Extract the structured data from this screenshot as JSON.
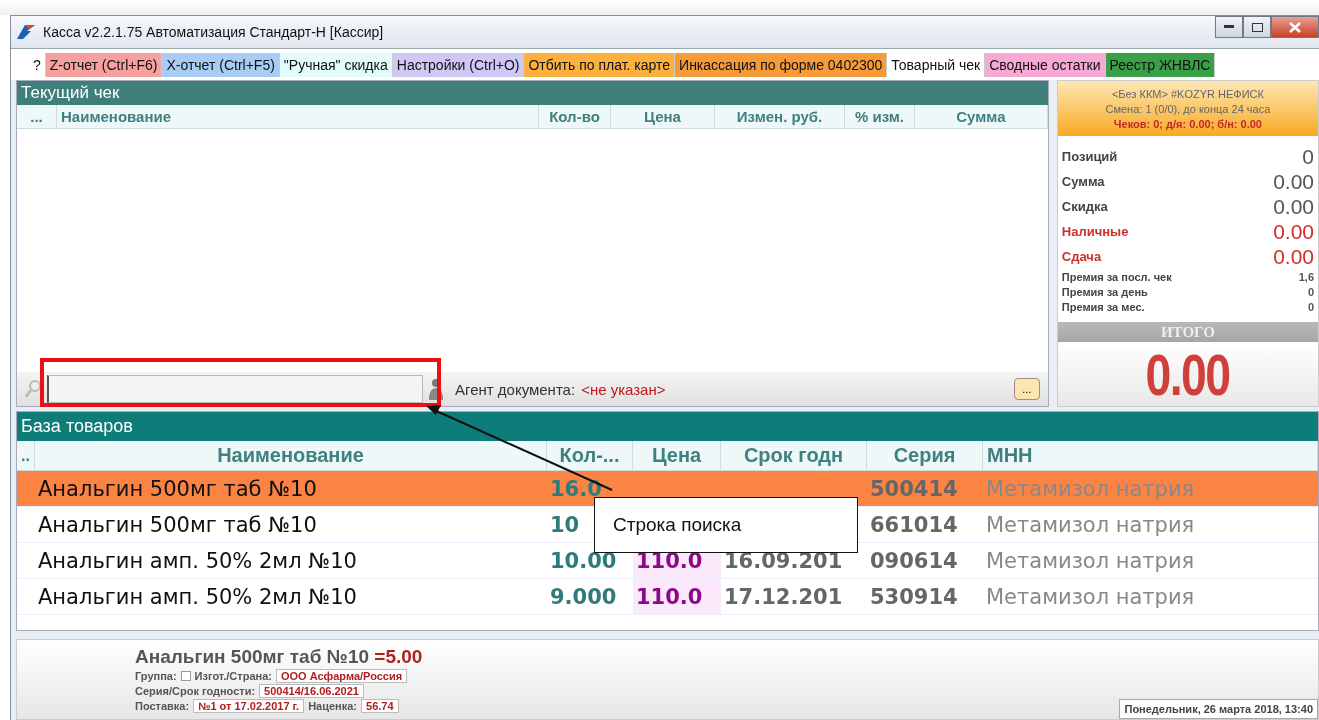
{
  "window": {
    "title": "Касса v2.2.1.75 Автоматизация Стандарт-Н [Кассир]"
  },
  "toolbar": [
    {
      "label": "?",
      "color": "#ffffff"
    },
    {
      "label": "Z-отчет (Ctrl+F6)",
      "color": "#f6a0a0"
    },
    {
      "label": "X-отчет (Ctrl+F5)",
      "color": "#a8ccf4"
    },
    {
      "label": "\"Ручная\" скидка",
      "color": "#e4fbfb"
    },
    {
      "label": "Настройки (Ctrl+O)",
      "color": "#cfc8f4"
    },
    {
      "label": "Отбить по плат. карте",
      "color": "#fbb040"
    },
    {
      "label": "Инкассация по форме 0402300",
      "color": "#f79a3a"
    },
    {
      "label": "Товарный чек",
      "color": "#ffffff"
    },
    {
      "label": "Сводные остатки",
      "color": "#f7a8d4"
    },
    {
      "label": "Реестр ЖНВЛС",
      "color": "#3aa048"
    }
  ],
  "current_check": {
    "title": "Текущий чек",
    "columns": [
      "...",
      "Наименование",
      "Кол-во",
      "Цена",
      "Измен. руб.",
      "% изм.",
      "Сумма"
    ],
    "agent_label": "Агент документа:",
    "agent_value": "<не указан>",
    "more_button": "..."
  },
  "register": {
    "header": [
      "<Без ККМ> #KOZYR НЕФИСК",
      "Смена: 1 (0/0), до конца 24 часа"
    ],
    "header_alert": "Чеков: 0; д/я: 0.00; б/н: 0.00",
    "stats": [
      {
        "label": "Позиций",
        "value": "0",
        "kind": "main"
      },
      {
        "label": "Сумма",
        "value": "0.00",
        "kind": "main"
      },
      {
        "label": "Скидка",
        "value": "0.00",
        "kind": "main"
      },
      {
        "label": "Наличные",
        "value": "0.00",
        "kind": "alert"
      },
      {
        "label": "Сдача",
        "value": "0.00",
        "kind": "alert"
      },
      {
        "label": "Премия за посл. чек",
        "value": "1,6",
        "kind": "small"
      },
      {
        "label": "Премия за день",
        "value": "0",
        "kind": "small"
      },
      {
        "label": "Премия за мес.",
        "value": "0",
        "kind": "small"
      }
    ],
    "total_label": "ИТОГО",
    "total": "0.00"
  },
  "products": {
    "title": "База товаров",
    "columns": [
      "..",
      "Наименование",
      "Кол-...",
      "Цена",
      "Срок годн",
      "Серия",
      "МНН"
    ],
    "rows": [
      {
        "selected": true,
        "name": "Анальгин 500мг таб №10",
        "qty": "16.0",
        "series": "500414",
        "inn": "Метамизол натрия"
      },
      {
        "selected": false,
        "name": "Анальгин 500мг таб №10",
        "qty": "10",
        "series": "661014",
        "inn": "Метамизол натрия"
      },
      {
        "selected": false,
        "name": "Анальгин амп. 50% 2мл №10",
        "qty": "10.00",
        "price": "110.0",
        "expiry": "16.09.201",
        "series": "090614",
        "inn": "Метамизол натрия"
      },
      {
        "selected": false,
        "name": "Анальгин амп. 50% 2мл №10",
        "qty": "9.000",
        "price": "110.0",
        "expiry": "17.12.201",
        "series": "530914",
        "inn": "Метамизол натрия"
      }
    ]
  },
  "details": {
    "name": "Анальгин 500мг таб №10",
    "price": "=5.00",
    "fields": [
      [
        {
          "label": "Группа:",
          "checked": false
        },
        {
          "label": "Изгот./Страна:",
          "value": "ООО Асфарма/Россия"
        }
      ],
      [
        {
          "label": "Серия/Срок годности:",
          "value": "500414/16.06.2021"
        }
      ],
      [
        {
          "label": "Поставка:",
          "value": "№1 от 17.02.2017 г."
        },
        {
          "label": "Наценка:",
          "value": "56.74"
        }
      ]
    ]
  },
  "status_date": "Понедельник, 26 марта 2018, 13:40",
  "annotation": {
    "label": "Строка поиска"
  }
}
